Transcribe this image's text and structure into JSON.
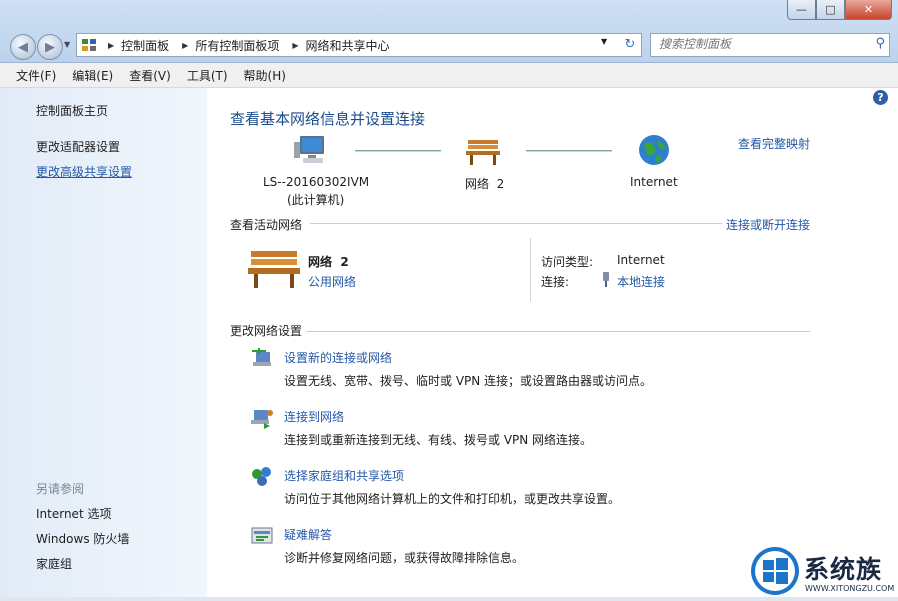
{
  "window": {
    "min": "0",
    "max": "1",
    "close": "r"
  },
  "address": {
    "crumbs": [
      "控制面板",
      "所有控制面板项",
      "网络和共享中心"
    ]
  },
  "search": {
    "placeholder": "搜索控制面板"
  },
  "menu": {
    "file": "文件(F)",
    "edit": "编辑(E)",
    "view": "查看(V)",
    "tools": "工具(T)",
    "help": "帮助(H)"
  },
  "sidebar": {
    "home": "控制面板主页",
    "adapter": "更改适配器设置",
    "advanced": "更改高级共享设置",
    "see_also": "另请参阅",
    "internet_options": "Internet 选项",
    "firewall": "Windows 防火墙",
    "homegroup": "家庭组"
  },
  "main": {
    "title": "查看基本网络信息并设置连接",
    "full_map": "查看完整映射",
    "computer_name": "LS--20160302IVM",
    "computer_sub": "(此计算机)",
    "network_name": "网络  2",
    "internet": "Internet",
    "active_head": "查看活动网络",
    "connect_disconnect": "连接或断开连接",
    "active_network": "网络  2",
    "public_network": "公用网络",
    "access_type_label": "访问类型:",
    "access_type_value": "Internet",
    "connection_label": "连接:",
    "connection_value": "本地连接",
    "change_head": "更改网络设置",
    "tasks": [
      {
        "title": "设置新的连接或网络",
        "desc": "设置无线、宽带、拨号、临时或 VPN 连接；或设置路由器或访问点。"
      },
      {
        "title": "连接到网络",
        "desc": "连接到或重新连接到无线、有线、拨号或 VPN 网络连接。"
      },
      {
        "title": "选择家庭组和共享选项",
        "desc": "访问位于其他网络计算机上的文件和打印机，或更改共享设置。"
      },
      {
        "title": "疑难解答",
        "desc": "诊断并修复网络问题，或获得故障排除信息。"
      }
    ]
  },
  "watermark": {
    "brand": "系统族",
    "url": "WWW.XITONGZU.COM"
  },
  "colors": {
    "link": "#2458a8",
    "title": "#1d4c8c",
    "sidebar": "#e1ebf7"
  }
}
